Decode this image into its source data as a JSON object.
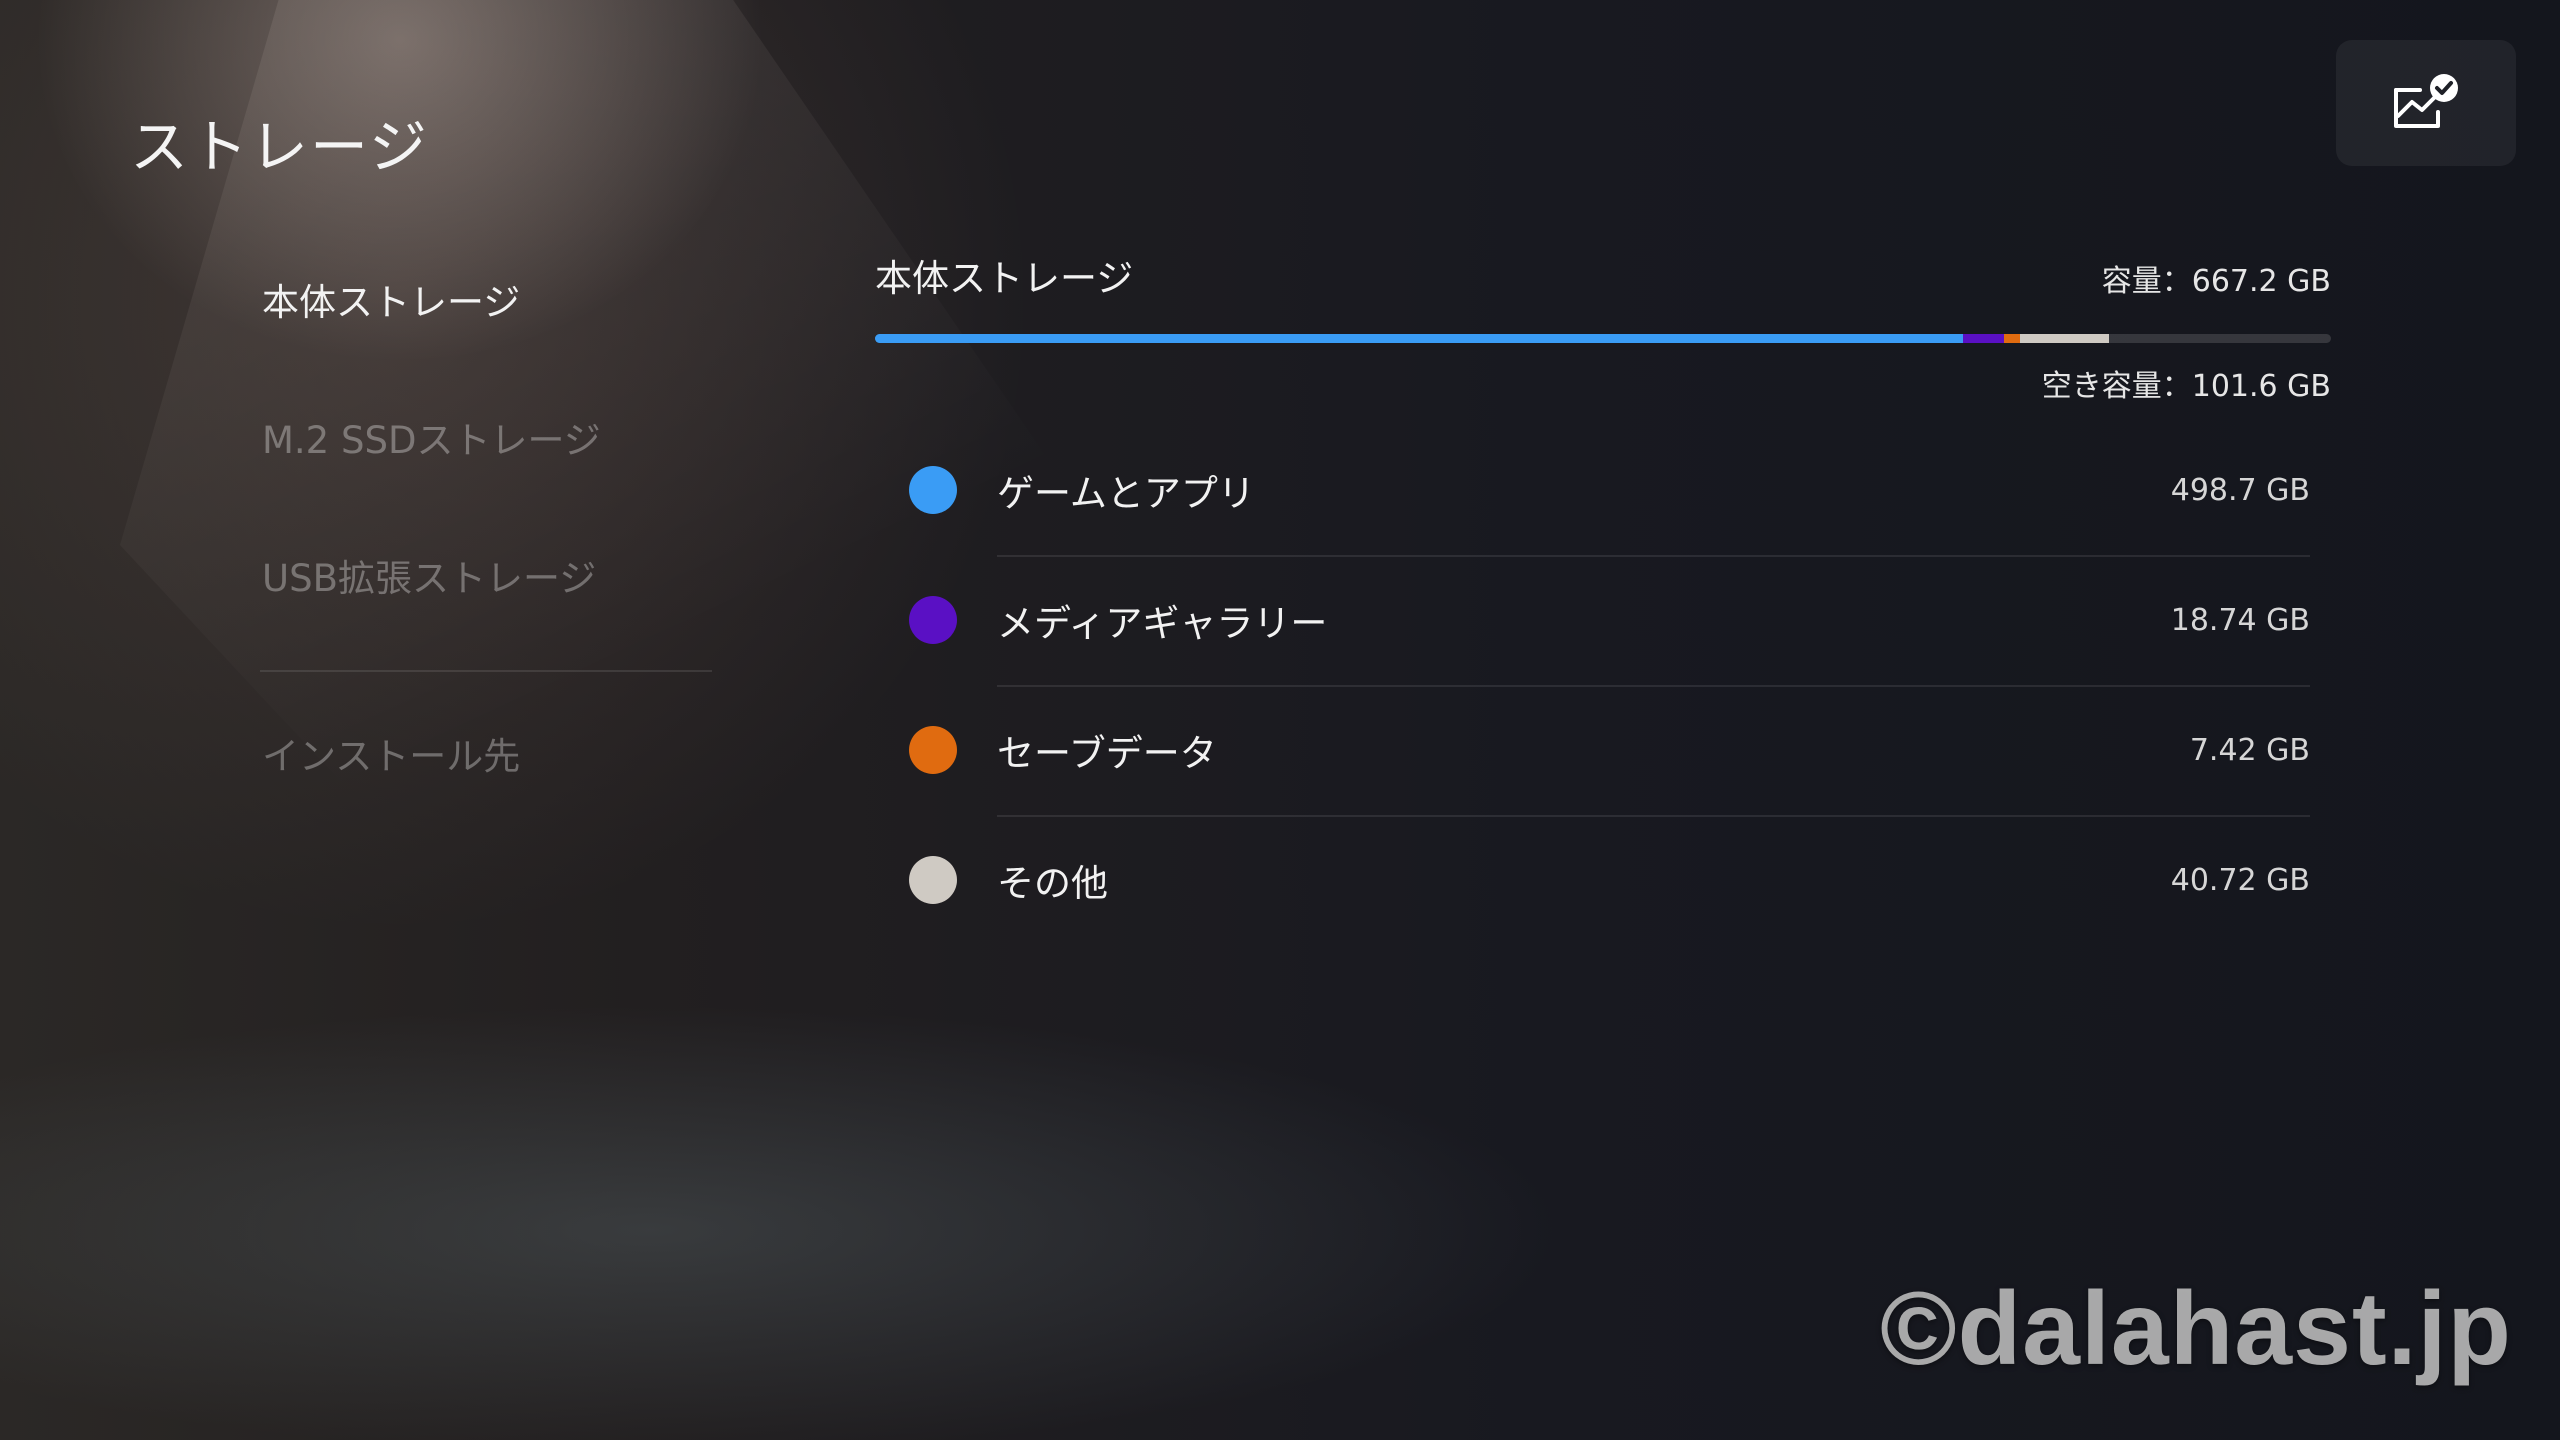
{
  "page": {
    "title": "ストレージ"
  },
  "toolbar": {
    "corner_icon": "storage-analysis-check-icon"
  },
  "sidebar": {
    "items": [
      {
        "label": "本体ストレージ",
        "selected": true
      },
      {
        "label": "M.2 SSDストレージ",
        "selected": false
      },
      {
        "label": "USB拡張ストレージ",
        "selected": false
      },
      {
        "label": "インストール先",
        "selected": false
      }
    ]
  },
  "main": {
    "title": "本体ストレージ",
    "capacity_text": "容量：667.2 GB",
    "free_text": "空き容量：101.6 GB",
    "capacity_gb": 667.2,
    "free_gb": 101.6,
    "categories": [
      {
        "label": "ゲームとアプリ",
        "size_text": "498.7 GB",
        "size_gb": 498.7,
        "color": "#3a9cf5"
      },
      {
        "label": "メディアギャラリー",
        "size_text": "18.74 GB",
        "size_gb": 18.74,
        "color": "#5a10c4"
      },
      {
        "label": "セーブデータ",
        "size_text": "7.42 GB",
        "size_gb": 7.42,
        "color": "#e06b10"
      },
      {
        "label": "その他",
        "size_text": "40.72 GB",
        "size_gb": 40.72,
        "color": "#cfcac3"
      }
    ]
  },
  "watermark": {
    "text": "©dalahast.jp"
  }
}
